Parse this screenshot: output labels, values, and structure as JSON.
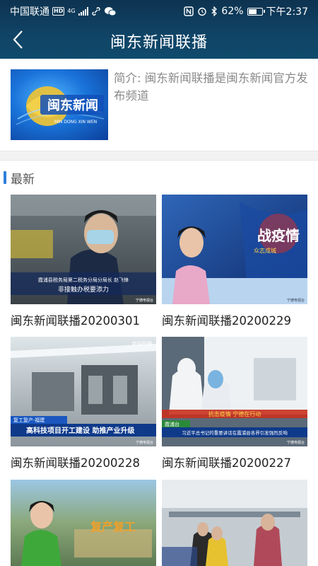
{
  "status": {
    "carrier": "中国联通",
    "hd_badge": "HD",
    "network_type": "4G",
    "battery_percent": "62%",
    "battery_level": 0.62,
    "time": "下午2:37"
  },
  "header": {
    "title": "闽东新闻联播"
  },
  "intro": {
    "logo_text": "闽东新闻",
    "logo_subtext": "MIN DONG XIN WEN",
    "description": "简介: 闽东新闻联播是闽东新闻官方发布频道"
  },
  "section": {
    "title": "最新"
  },
  "videos": [
    {
      "title": "闽东新闻联播20200301",
      "overlay_caption": "霞浦县税务局第二税务分局分局长 赵飞锋",
      "overlay_subtitle": "非接触办税要添力",
      "watermark": "宁德电视台"
    },
    {
      "title": "闽东新闻联播20200229",
      "overlay_tag": "战疫情",
      "overlay_small": "众志成城",
      "watermark": "宁德电视台"
    },
    {
      "title": "闽东新闻联播20200228",
      "overlay_tag": "复工复产·福建",
      "overlay_headline": "高科技项目开工建设 助推产业升级",
      "overlay_corner": "新闻联播",
      "watermark": "宁德电视台"
    },
    {
      "title": "闽东新闻联播20200227",
      "overlay_top": "抗击疫情 宁德在行动",
      "overlay_location": "霞浦台",
      "overlay_headline": "习近平总书记的重要讲话在霞浦县各界引发强烈反响",
      "watermark": "宁德电视台"
    },
    {
      "title": "",
      "overlay_tag": "复产复工"
    },
    {
      "title": ""
    }
  ],
  "colors": {
    "header_bg": "#0f4466",
    "accent": "#2d7fd9",
    "intro_text": "#8a8a8a"
  }
}
